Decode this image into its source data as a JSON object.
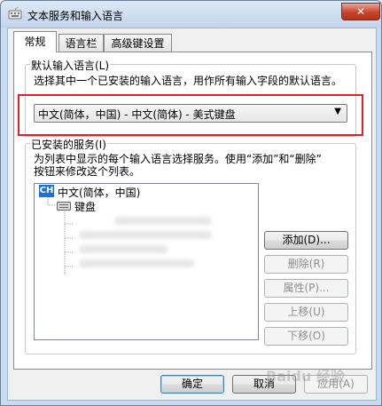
{
  "window": {
    "title": "文本服务和输入语言",
    "close_label": "✕"
  },
  "tabs": [
    {
      "label": "常规"
    },
    {
      "label": "语言栏"
    },
    {
      "label": "高级键设置"
    }
  ],
  "default_language": {
    "group_title": "默认输入语言(L)",
    "description": "选择其中一个已安装的输入语言，用作所有输入字段的默认语言。",
    "selected": "中文(简体，中国) - 中文(简体) - 美式键盘",
    "arrow": "▼"
  },
  "installed_services": {
    "group_title": "已安装的服务(I)",
    "description_line1": "为列表中显示的每个输入语言选择服务。使用“添加”和“删除”",
    "description_line2": "按钮来修改这个列表。",
    "tree": {
      "badge": "CH",
      "language": "中文(简体，中国)",
      "category": "键盘"
    },
    "buttons": {
      "add": "添加(D)...",
      "remove": "删除(R)",
      "properties": "属性(P)...",
      "move_up": "上移(U)",
      "move_down": "下移(O)"
    }
  },
  "footer": {
    "ok": "确定",
    "cancel": "取消",
    "apply": "应用(A)"
  },
  "watermark": "Baidu 经验",
  "colors": {
    "highlight_border": "#e0202a",
    "language_badge": "#1e6fd9"
  }
}
